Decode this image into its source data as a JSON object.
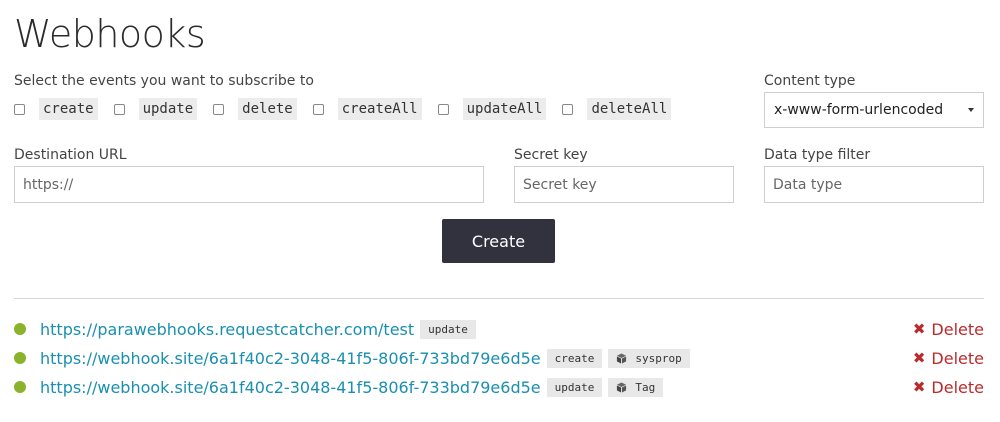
{
  "page": {
    "title": "Webhooks"
  },
  "events": {
    "label": "Select the events you want to subscribe to",
    "options": [
      "create",
      "update",
      "delete",
      "createAll",
      "updateAll",
      "deleteAll"
    ]
  },
  "content_type": {
    "label": "Content type",
    "value": "x-www-form-urlencoded"
  },
  "destination": {
    "label": "Destination URL",
    "placeholder": "https://"
  },
  "secret": {
    "label": "Secret key",
    "placeholder": "Secret key"
  },
  "filter": {
    "label": "Data type filter",
    "placeholder": "Data type"
  },
  "create_label": "Create",
  "webhooks": [
    {
      "url": "https://parawebhooks.requestcatcher.com/test",
      "event": "update",
      "type": "",
      "delete_label": "Delete",
      "status_color": "#8ab22c"
    },
    {
      "url": "https://webhook.site/6a1f40c2-3048-41f5-806f-733bd79e6d5e",
      "event": "create",
      "type": "sysprop",
      "delete_label": "Delete",
      "status_color": "#8ab22c"
    },
    {
      "url": "https://webhook.site/6a1f40c2-3048-41f5-806f-733bd79e6d5e",
      "event": "update",
      "type": "Tag",
      "delete_label": "Delete",
      "status_color": "#8ab22c"
    }
  ],
  "colors": {
    "link": "#1a8fb0",
    "delete": "#b92c2c",
    "button": "#32323f"
  }
}
